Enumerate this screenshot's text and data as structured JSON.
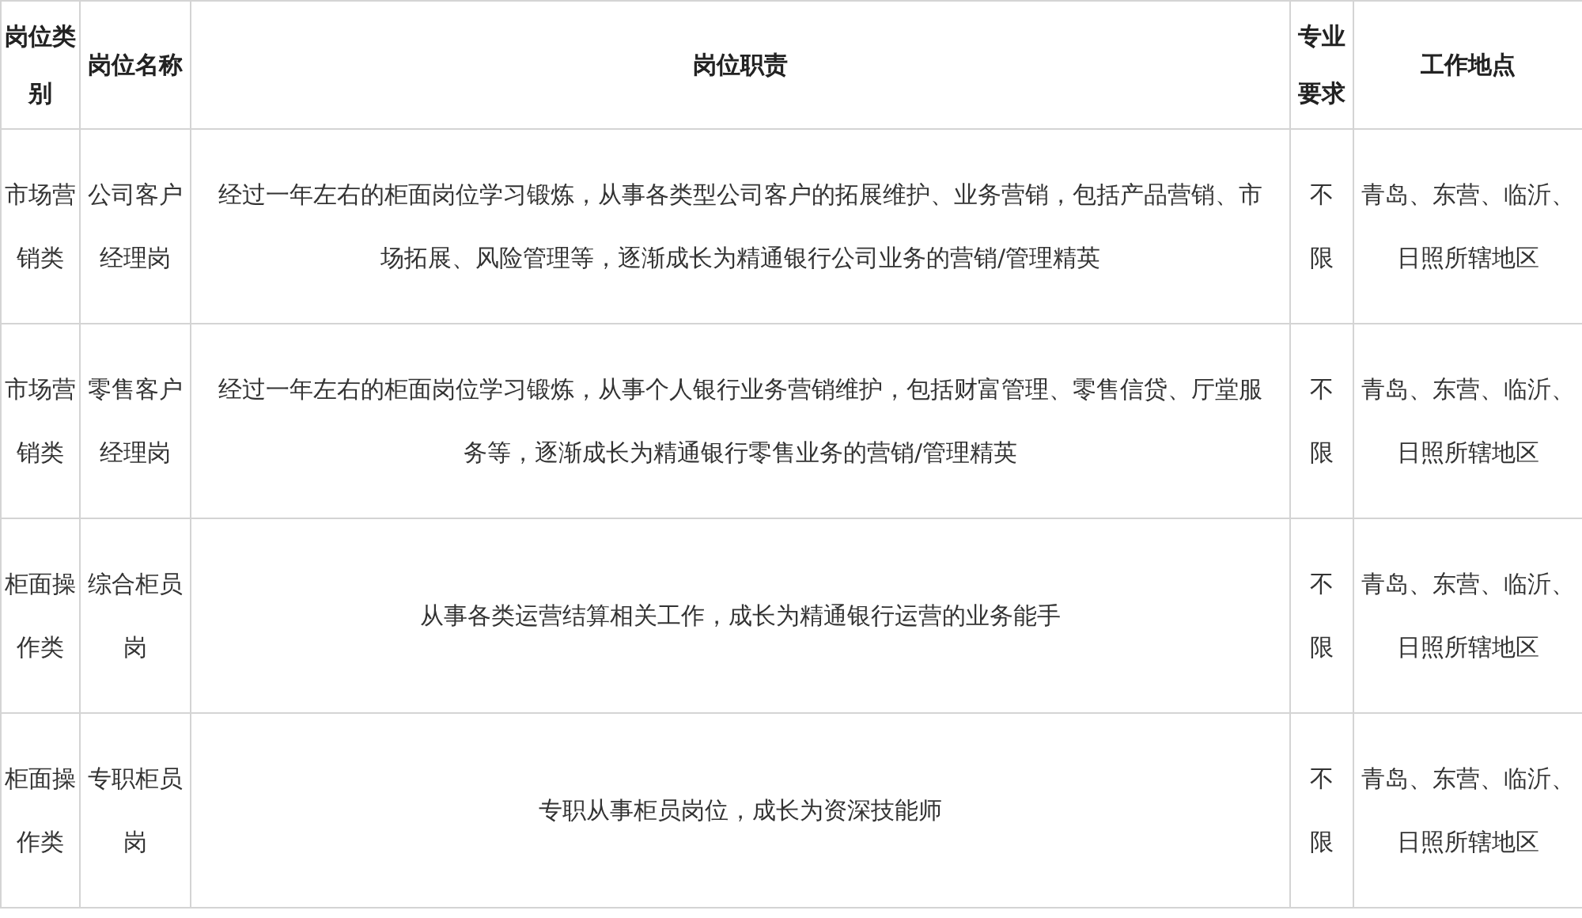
{
  "table": {
    "columns": [
      "岗位类别",
      "岗位名称",
      "岗位职责",
      "专业要求",
      "工作地点"
    ],
    "rows": [
      [
        "市场营销类",
        "公司客户经理岗",
        "经过一年左右的柜面岗位学习锻炼，从事各类型公司客户的拓展维护、业务营销，包括产品营销、市场拓展、风险管理等，逐渐成长为精通银行公司业务的营销/管理精英",
        "不限",
        "青岛、东营、临沂、日照所辖地区"
      ],
      [
        "市场营销类",
        "零售客户经理岗",
        "经过一年左右的柜面岗位学习锻炼，从事个人银行业务营销维护，包括财富管理、零售信贷、厅堂服务等，逐渐成长为精通银行零售业务的营销/管理精英",
        "不限",
        "青岛、东营、临沂、日照所辖地区"
      ],
      [
        "柜面操作类",
        "综合柜员岗",
        "从事各类运营结算相关工作，成长为精通银行运营的业务能手",
        "不限",
        "青岛、东营、临沂、日照所辖地区"
      ],
      [
        "柜面操作类",
        "专职柜员岗",
        "专职从事柜员岗位，成长为资深技能师",
        "不限",
        "青岛、东营、临沂、日照所辖地区"
      ]
    ]
  }
}
